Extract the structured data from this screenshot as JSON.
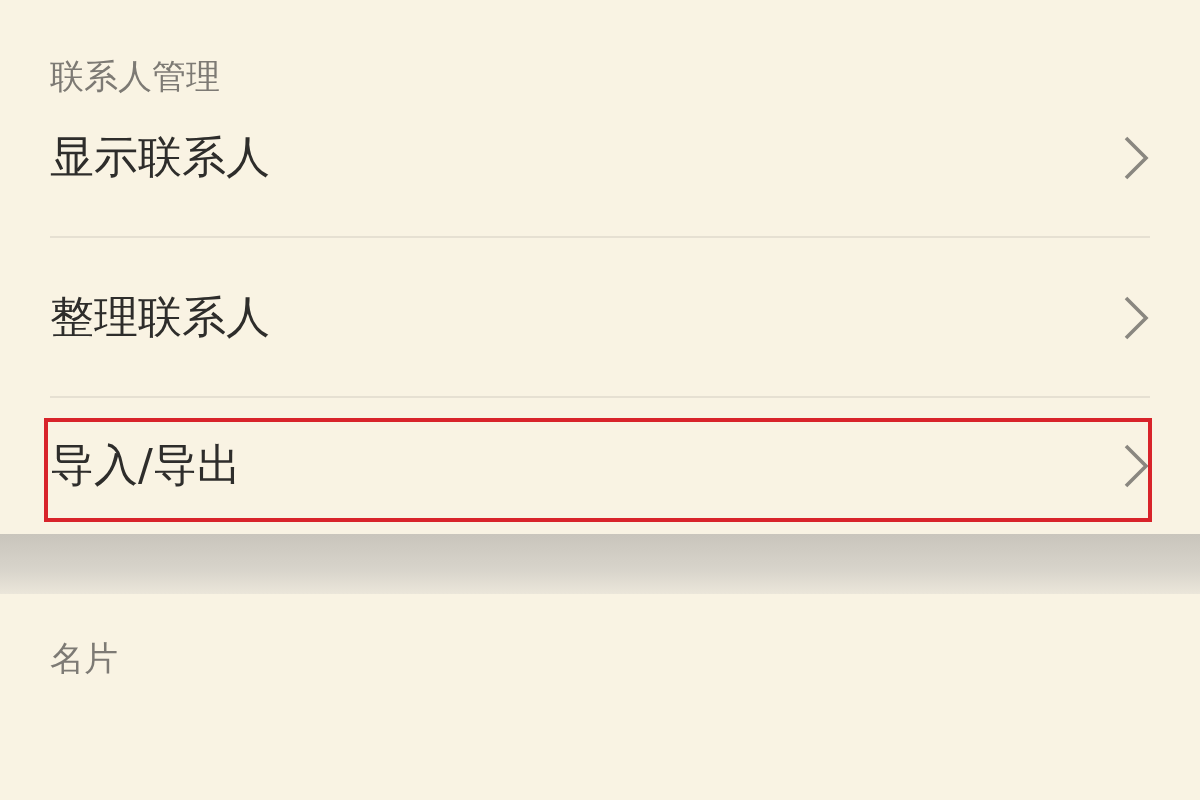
{
  "section_title": "联系人管理",
  "items": [
    {
      "label": "显示联系人",
      "highlighted": false
    },
    {
      "label": "整理联系人",
      "highlighted": false
    },
    {
      "label": "导入/导出",
      "highlighted": true
    }
  ],
  "next_section_title": "名片"
}
